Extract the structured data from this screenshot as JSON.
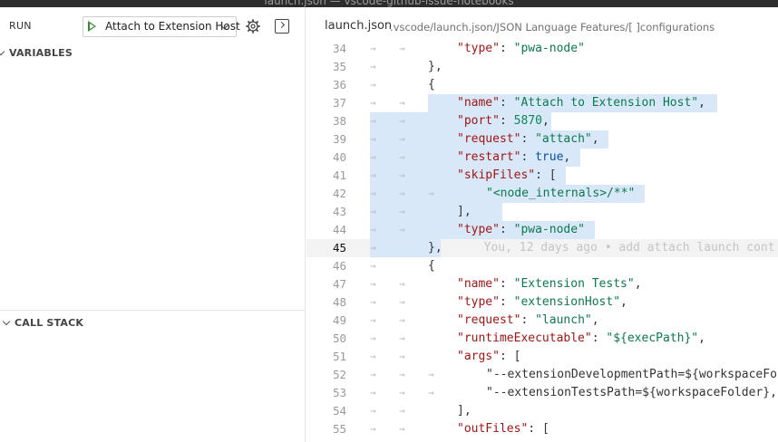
{
  "window": {
    "title": "launch.json — vscode-github-issue-notebooks"
  },
  "sidebar": {
    "run_label": "RUN",
    "config_selected": "Attach to Extension Host",
    "variables_label": "VARIABLES",
    "call_stack_label": "CALL STACK"
  },
  "editor": {
    "file": "launch.json",
    "breadcrumb_path": ".vscode/launch.json/JSON Language Features/[ ]configurations",
    "current_line": 45,
    "blame": "You, 12 days ago • add attach launch cont",
    "lines": [
      {
        "n": "34",
        "text": "\"type\": \"pwa-node\""
      },
      {
        "n": "35",
        "text": "},"
      },
      {
        "n": "36",
        "text": "{"
      },
      {
        "n": "37",
        "text": "\"name\": \"Attach to Extension Host\","
      },
      {
        "n": "38",
        "text": "\"port\": 5870,"
      },
      {
        "n": "39",
        "text": "\"request\": \"attach\","
      },
      {
        "n": "40",
        "text": "\"restart\": true,"
      },
      {
        "n": "41",
        "text": "\"skipFiles\": ["
      },
      {
        "n": "42",
        "text": "\"<node_internals>/**\""
      },
      {
        "n": "43",
        "text": "],"
      },
      {
        "n": "44",
        "text": "\"type\": \"pwa-node\""
      },
      {
        "n": "45",
        "text": "},"
      },
      {
        "n": "46",
        "text": "{"
      },
      {
        "n": "47",
        "text": "\"name\": \"Extension Tests\","
      },
      {
        "n": "48",
        "text": "\"type\": \"extensionHost\","
      },
      {
        "n": "49",
        "text": "\"request\": \"launch\","
      },
      {
        "n": "50",
        "text": "\"runtimeExecutable\": \"${execPath}\","
      },
      {
        "n": "51",
        "text": "\"args\": ["
      },
      {
        "n": "52",
        "text": "\"--extensionDevelopmentPath=${workspaceFo"
      },
      {
        "n": "53",
        "text": "\"--extensionTestsPath=${workspaceFolder},"
      },
      {
        "n": "54",
        "text": "],"
      },
      {
        "n": "55",
        "text": "\"outFiles\": ["
      }
    ]
  },
  "colors": {
    "selection": "#d9e8f8",
    "key": "#a31515",
    "string": "#0b7a4d",
    "number": "#098658",
    "run_icon": "#388a34"
  }
}
